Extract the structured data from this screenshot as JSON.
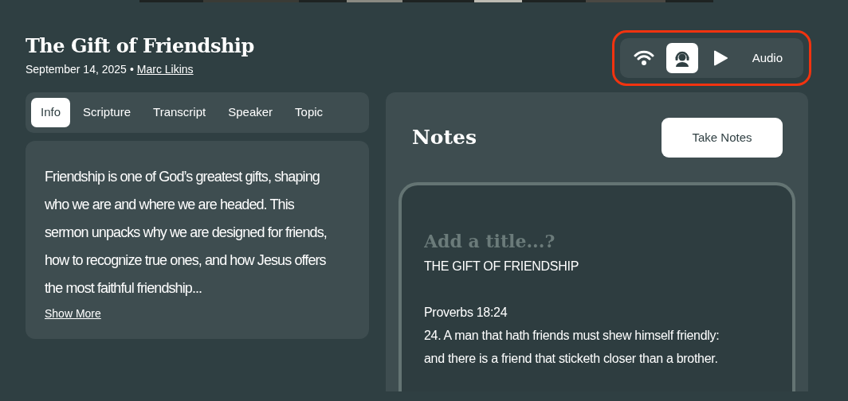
{
  "header": {
    "title": "The Gift of Friendship",
    "date": "September 14, 2025",
    "separator": "•",
    "speaker": "Marc Likins"
  },
  "media_switch": {
    "highlighted": true,
    "options": [
      {
        "kind": "live",
        "selected": false
      },
      {
        "kind": "listen",
        "selected": true
      },
      {
        "kind": "play",
        "selected": false
      }
    ],
    "label": "Audio"
  },
  "tabs": [
    {
      "label": "Info",
      "selected": true
    },
    {
      "label": "Scripture",
      "selected": false
    },
    {
      "label": "Transcript",
      "selected": false
    },
    {
      "label": "Speaker",
      "selected": false
    },
    {
      "label": "Topic",
      "selected": false
    }
  ],
  "info": {
    "description": "Friendship is one of God’s greatest gifts, shaping who we are and where we are headed. This sermon unpacks why we are designed for friends, how to recognize true ones, and how Jesus offers the most faithful friendship...",
    "link": "Show More"
  },
  "notes": {
    "heading": "Notes",
    "button": "Take Notes",
    "title_field": {
      "placeholder": "Add a title...?"
    },
    "lines": [
      {
        "text": "THE GIFT OF FRIENDSHIP",
        "gap_before": false
      },
      {
        "text": "Proverbs 18:24",
        "gap_before": true
      },
      {
        "text": "24. A man that hath friends must shew himself friendly:",
        "gap_before": false
      },
      {
        "text": "and there is a friend that sticketh closer than a brother.",
        "gap_before": false
      }
    ]
  }
}
